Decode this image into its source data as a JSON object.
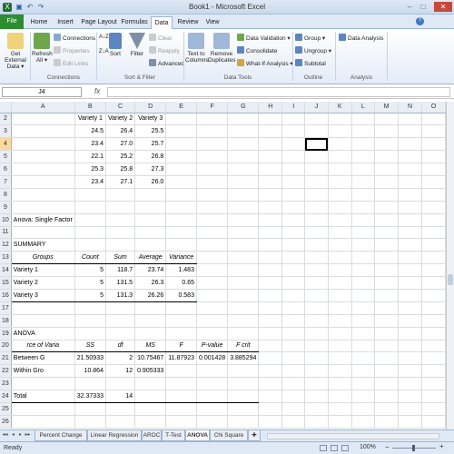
{
  "titlebar": {
    "title": "Book1 - Microsoft Excel",
    "min": "–",
    "max": "□",
    "close": "✕"
  },
  "tabs": [
    {
      "label": "File"
    },
    {
      "label": "Home"
    },
    {
      "label": "Insert"
    },
    {
      "label": "Page Layout"
    },
    {
      "label": "Formulas"
    },
    {
      "label": "Data"
    },
    {
      "label": "Review"
    },
    {
      "label": "View"
    }
  ],
  "ribbon": {
    "get_external": "Get External Data ▾",
    "refresh": "Refresh All ▾",
    "connections": "Connections",
    "properties": "Properties",
    "edit_links": "Edit Links",
    "sort": "Sort",
    "filter": "Filter",
    "clear": "Clear",
    "reapply": "Reapply",
    "advanced": "Advanced",
    "text_to_columns": "Text to Columns",
    "remove_duplicates": "Remove Duplicates",
    "data_validation": "Data Validation ▾",
    "consolidate": "Consolidate",
    "what_if": "What-If Analysis ▾",
    "group": "Group ▾",
    "ungroup": "Ungroup ▾",
    "subtotal": "Subtotal",
    "data_analysis": "Data Analysis",
    "group_labels": {
      "connections": "Connections",
      "sort_filter": "Sort & Filter",
      "data_tools": "Data Tools",
      "outline": "Outline",
      "analysis": "Analysis"
    }
  },
  "formula_bar": {
    "name_box": "J4",
    "fx": "fx",
    "value": ""
  },
  "grid": {
    "columns": [
      "A",
      "B",
      "C",
      "D",
      "E",
      "F",
      "G",
      "H",
      "I",
      "J",
      "K",
      "L",
      "M",
      "N",
      "O"
    ],
    "rows": [
      {
        "n": "2",
        "c": [
          "",
          "Variety 1",
          "Variety 2",
          "Variety 3",
          "",
          "",
          "",
          "",
          "",
          "",
          "",
          "",
          "",
          "",
          ""
        ]
      },
      {
        "n": "3",
        "c": [
          "",
          "24.5",
          "26.4",
          "25.5",
          "",
          "",
          "",
          "",
          "",
          "",
          "",
          "",
          "",
          "",
          ""
        ]
      },
      {
        "n": "4",
        "c": [
          "",
          "23.4",
          "27.0",
          "25.7",
          "",
          "",
          "",
          "",
          "",
          "",
          "",
          "",
          "",
          "",
          ""
        ]
      },
      {
        "n": "5",
        "c": [
          "",
          "22.1",
          "25.2",
          "26.8",
          "",
          "",
          "",
          "",
          "",
          "",
          "",
          "",
          "",
          "",
          ""
        ]
      },
      {
        "n": "6",
        "c": [
          "",
          "25.3",
          "25.8",
          "27.3",
          "",
          "",
          "",
          "",
          "",
          "",
          "",
          "",
          "",
          "",
          ""
        ]
      },
      {
        "n": "7",
        "c": [
          "",
          "23.4",
          "27.1",
          "26.0",
          "",
          "",
          "",
          "",
          "",
          "",
          "",
          "",
          "",
          "",
          ""
        ]
      },
      {
        "n": "8",
        "c": [
          "",
          "",
          "",
          "",
          "",
          "",
          "",
          "",
          "",
          "",
          "",
          "",
          "",
          "",
          ""
        ]
      },
      {
        "n": "9",
        "c": [
          "",
          "",
          "",
          "",
          "",
          "",
          "",
          "",
          "",
          "",
          "",
          "",
          "",
          "",
          ""
        ]
      },
      {
        "n": "10",
        "c": [
          "Anova: Single Factor",
          "",
          "",
          "",
          "",
          "",
          "",
          "",
          "",
          "",
          "",
          "",
          "",
          "",
          ""
        ]
      },
      {
        "n": "11",
        "c": [
          "",
          "",
          "",
          "",
          "",
          "",
          "",
          "",
          "",
          "",
          "",
          "",
          "",
          "",
          ""
        ]
      },
      {
        "n": "12",
        "c": [
          "SUMMARY",
          "",
          "",
          "",
          "",
          "",
          "",
          "",
          "",
          "",
          "",
          "",
          "",
          "",
          ""
        ]
      },
      {
        "n": "13",
        "c": [
          "Groups",
          "Count",
          "Sum",
          "Average",
          "Variance",
          "",
          "",
          "",
          "",
          "",
          "",
          "",
          "",
          "",
          ""
        ]
      },
      {
        "n": "14",
        "c": [
          "Variety 1",
          "5",
          "118.7",
          "23.74",
          "1.483",
          "",
          "",
          "",
          "",
          "",
          "",
          "",
          "",
          "",
          ""
        ]
      },
      {
        "n": "15",
        "c": [
          "Variety 2",
          "5",
          "131.5",
          "26.3",
          "0.65",
          "",
          "",
          "",
          "",
          "",
          "",
          "",
          "",
          "",
          ""
        ]
      },
      {
        "n": "16",
        "c": [
          "Variety 3",
          "5",
          "131.3",
          "26.26",
          "0.583",
          "",
          "",
          "",
          "",
          "",
          "",
          "",
          "",
          "",
          ""
        ]
      },
      {
        "n": "17",
        "c": [
          "",
          "",
          "",
          "",
          "",
          "",
          "",
          "",
          "",
          "",
          "",
          "",
          "",
          "",
          ""
        ]
      },
      {
        "n": "18",
        "c": [
          "",
          "",
          "",
          "",
          "",
          "",
          "",
          "",
          "",
          "",
          "",
          "",
          "",
          "",
          ""
        ]
      },
      {
        "n": "19",
        "c": [
          "ANOVA",
          "",
          "",
          "",
          "",
          "",
          "",
          "",
          "",
          "",
          "",
          "",
          "",
          "",
          ""
        ]
      },
      {
        "n": "20",
        "c": [
          "rce of Varia",
          "SS",
          "df",
          "MS",
          "F",
          "P-value",
          "F crit",
          "",
          "",
          "",
          "",
          "",
          "",
          "",
          ""
        ]
      },
      {
        "n": "21",
        "c": [
          "Between G",
          "21.50933",
          "2",
          "10.75467",
          "11.87923",
          "0.001428",
          "3.885294",
          "",
          "",
          "",
          "",
          "",
          "",
          "",
          ""
        ]
      },
      {
        "n": "22",
        "c": [
          "Within Gro",
          "10.864",
          "12",
          "0.905333",
          "",
          "",
          "",
          "",
          "",
          "",
          "",
          "",
          "",
          "",
          ""
        ]
      },
      {
        "n": "23",
        "c": [
          "",
          "",
          "",
          "",
          "",
          "",
          "",
          "",
          "",
          "",
          "",
          "",
          "",
          "",
          ""
        ]
      },
      {
        "n": "24",
        "c": [
          "Total",
          "32.37333",
          "14",
          "",
          "",
          "",
          "",
          "",
          "",
          "",
          "",
          "",
          "",
          "",
          ""
        ]
      },
      {
        "n": "25",
        "c": [
          "",
          "",
          "",
          "",
          "",
          "",
          "",
          "",
          "",
          "",
          "",
          "",
          "",
          "",
          ""
        ]
      },
      {
        "n": "26",
        "c": [
          "",
          "",
          "",
          "",
          "",
          "",
          "",
          "",
          "",
          "",
          "",
          "",
          "",
          "",
          ""
        ]
      }
    ]
  },
  "sheet_tabs": [
    "Percent Change",
    "Linear Regression",
    "AROC",
    "T-Test",
    "ANOVA",
    "Chi Square"
  ],
  "active_sheet": "ANOVA",
  "status": {
    "left": "Ready",
    "zoom": "100%"
  }
}
